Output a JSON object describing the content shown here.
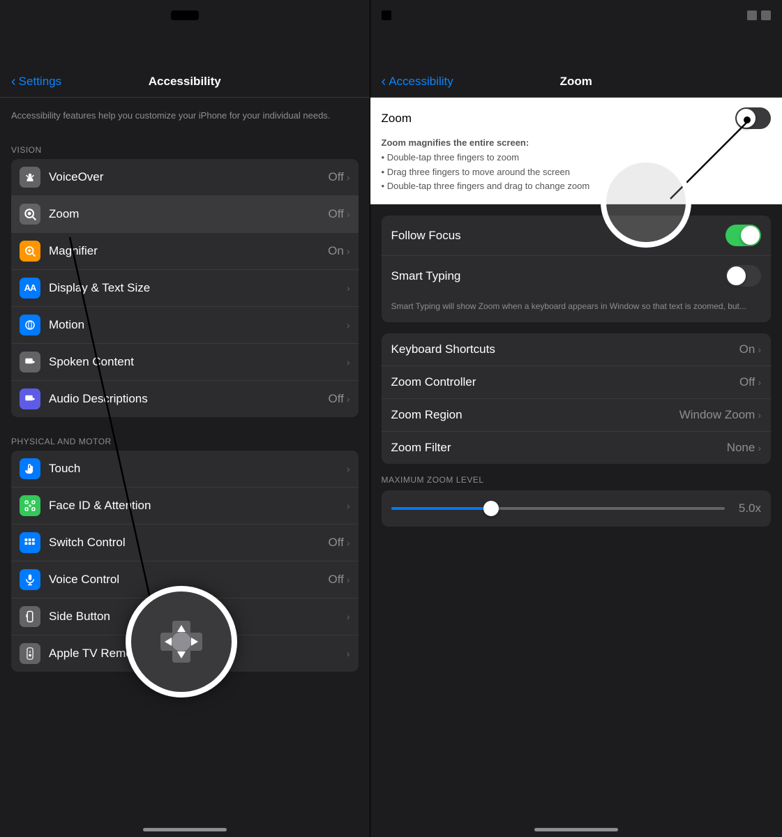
{
  "left_panel": {
    "status_bar": {},
    "nav_bar": {
      "back_label": "Settings",
      "title": "Accessibility"
    },
    "description": "Accessibility features help you customize your iPhone for your individual needs.",
    "sections": [
      {
        "header": "VISION",
        "items": [
          {
            "id": "voiceover",
            "label": "VoiceOver",
            "value": "Off",
            "icon_color": "gray",
            "icon": "🔊"
          },
          {
            "id": "zoom",
            "label": "Zoom",
            "value": "Off",
            "icon_color": "gray",
            "icon": "🔍",
            "selected": true
          },
          {
            "id": "magnifier",
            "label": "Magnifier",
            "value": "On",
            "icon_color": "orange",
            "icon": "🔎"
          },
          {
            "id": "display-text-size",
            "label": "Display & Text Size",
            "value": "",
            "icon_color": "blue",
            "icon": "AA"
          },
          {
            "id": "motion",
            "label": "Motion",
            "value": "",
            "icon_color": "blue",
            "icon": "⚙"
          },
          {
            "id": "spoken-content",
            "label": "Spoken Content",
            "value": "",
            "icon_color": "gray",
            "icon": "💬"
          },
          {
            "id": "audio-descriptions",
            "label": "Audio Descriptions",
            "value": "Off",
            "icon_color": "indigo",
            "icon": "💬"
          }
        ]
      },
      {
        "header": "PHYSICAL AND MOTOR",
        "items": [
          {
            "id": "touch",
            "label": "Touch",
            "value": "",
            "icon_color": "blue2",
            "icon": "👆"
          },
          {
            "id": "face-id",
            "label": "Face ID & Attention",
            "value": "",
            "icon_color": "green2",
            "icon": "😊"
          },
          {
            "id": "switch-control",
            "label": "Switch Control",
            "value": "Off",
            "icon_color": "blue3",
            "icon": "⬛"
          },
          {
            "id": "voice-control",
            "label": "Voice Control",
            "value": "Off",
            "icon_color": "blue3",
            "icon": "🎙"
          },
          {
            "id": "side-button",
            "label": "Side Button",
            "value": "",
            "icon_color": "gray2",
            "icon": "↩"
          },
          {
            "id": "apple-tv-remote",
            "label": "Apple TV Remote",
            "value": "",
            "icon_color": "gray2",
            "icon": "📱"
          }
        ]
      }
    ]
  },
  "right_panel": {
    "status_bar": {},
    "nav_bar": {
      "back_label": "Accessibility",
      "title": "Zoom"
    },
    "zoom_toggle": {
      "label": "Zoom",
      "state": "off"
    },
    "zoom_description": {
      "bold": "Zoom magnifies the entire screen:",
      "bullets": [
        "Double-tap three fingers to zoom",
        "Drag three fingers to move around the screen",
        "Double-tap three fingers and drag to change zoom"
      ]
    },
    "settings": [
      {
        "id": "follow-focus",
        "label": "Follow Focus",
        "toggle": true,
        "toggle_state": "on"
      },
      {
        "id": "smart-typing",
        "label": "Smart Typing",
        "toggle": true,
        "toggle_state": "off"
      },
      {
        "id": "smart-typing-desc",
        "text": "Smart Typing will show Zoom when a keyboard appears in Window so that text is zoomed, but..."
      }
    ],
    "list_items": [
      {
        "id": "keyboard-shortcuts",
        "label": "Keyboard Shortcuts",
        "value": "On"
      },
      {
        "id": "zoom-controller",
        "label": "Zoom Controller",
        "value": "Off"
      },
      {
        "id": "zoom-region",
        "label": "Zoom Region",
        "value": "Window Zoom"
      },
      {
        "id": "zoom-filter",
        "label": "Zoom Filter",
        "value": "None"
      }
    ],
    "max_zoom": {
      "header": "MAXIMUM ZOOM LEVEL",
      "value": "5.0x",
      "slider_percent": 30
    }
  }
}
